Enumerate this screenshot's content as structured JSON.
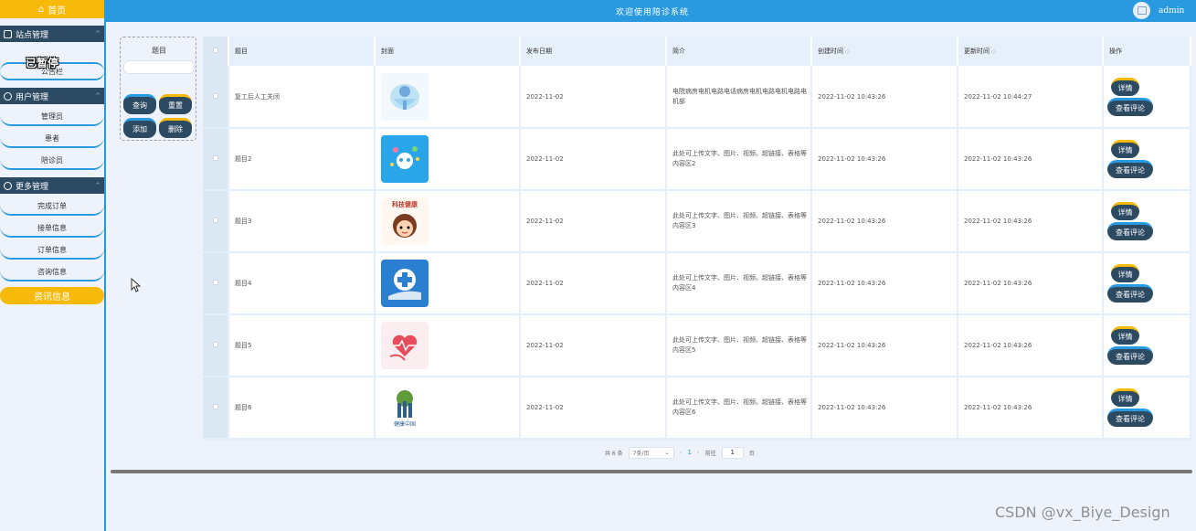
{
  "sidebar": {
    "home": "首页",
    "groups": [
      {
        "title": "站点管理",
        "items": [
          "公告栏"
        ]
      },
      {
        "title": "用户管理",
        "items": [
          "管理员",
          "患者",
          "陪诊员"
        ]
      },
      {
        "title": "更多管理",
        "items": [
          "完成订单",
          "接单信息",
          "订单信息",
          "咨询信息"
        ]
      }
    ],
    "overlap_label": "已暂停",
    "active_item": "资讯信息"
  },
  "header": {
    "title": "欢迎使用陪诊系统",
    "user": "admin"
  },
  "search": {
    "label": "题目",
    "placeholder": "",
    "buttons": {
      "query": "查询",
      "reset": "重置",
      "add": "添加",
      "delete": "删除"
    }
  },
  "table": {
    "columns": [
      "题目",
      "封面",
      "发布日期",
      "简介",
      "创建时间",
      "更新时间",
      "操作"
    ],
    "rows": [
      {
        "title": "复工后人工关闭",
        "date": "2022-11-02",
        "intro": "电院病房电机电路电话病房电机电路电机电路电机部",
        "created": "2022-11-02 10:43:26",
        "updated": "2022-11-02 10:44:27"
      },
      {
        "title": "题目2",
        "date": "2022-11-02",
        "intro": "此处可上传文字、图片、视频、超链接、表格等内容区2",
        "created": "2022-11-02 10:43:26",
        "updated": "2022-11-02 10:43:26"
      },
      {
        "title": "题目3",
        "date": "2022-11-02",
        "intro": "此处可上传文字、图片、视频、超链接、表格等内容区3",
        "created": "2022-11-02 10:43:26",
        "updated": "2022-11-02 10:43:26"
      },
      {
        "title": "题目4",
        "date": "2022-11-02",
        "intro": "此处可上传文字、图片、视频、超链接、表格等内容区4",
        "created": "2022-11-02 10:43:26",
        "updated": "2022-11-02 10:43:26"
      },
      {
        "title": "题目5",
        "date": "2022-11-02",
        "intro": "此处可上传文字、图片、视频、超链接、表格等内容区5",
        "created": "2022-11-02 10:43:26",
        "updated": "2022-11-02 10:43:26"
      },
      {
        "title": "题目6",
        "date": "2022-11-02",
        "intro": "此处可上传文字、图片、视频、超链接、表格等内容区6",
        "created": "2022-11-02 10:43:26",
        "updated": "2022-11-02 10:43:26"
      }
    ],
    "actions": {
      "detail": "详情",
      "review": "查看评论"
    },
    "cover_texts": {
      "row3": "科技健康",
      "row6": "健康中国"
    }
  },
  "pagination": {
    "total": "共 6 条",
    "page_size": "7条/页",
    "current": "1",
    "goto_label": "前往",
    "goto_value": "1",
    "page_suffix": "页"
  },
  "watermark": "CSDN @vx_Biye_Design",
  "colors": {
    "primary": "#2a9ae0",
    "accent": "#f7b90a",
    "dark": "#2d4a63"
  }
}
